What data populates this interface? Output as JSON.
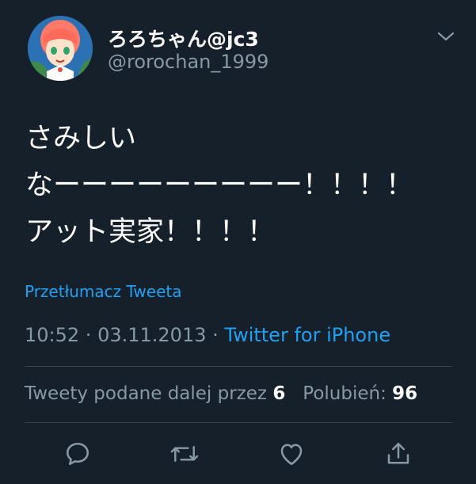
{
  "author": {
    "display_name": "ろろちゃん@jc3",
    "handle": "@rorochan_1999"
  },
  "tweet": {
    "lines": [
      "さみしい",
      "なーーーーーーーーー！！！！",
      "アット実家！！！！"
    ]
  },
  "translate_label": "Przetłumacz Tweeta",
  "meta": {
    "time": "10:52",
    "sep1": " · ",
    "date": "03.11.2013",
    "sep2": " · ",
    "source": "Twitter for iPhone"
  },
  "stats": {
    "retweets_label": "Tweety podane dalej przez",
    "retweets_count": "6",
    "likes_label": "Polubień:",
    "likes_count": "96"
  },
  "colors": {
    "background": "#15202b",
    "accent": "#1da1f2",
    "secondary_text": "#8899a6",
    "divider": "#38444d"
  },
  "icons": [
    "chevron-down-icon",
    "reply-icon",
    "retweet-icon",
    "like-icon",
    "share-icon"
  ]
}
